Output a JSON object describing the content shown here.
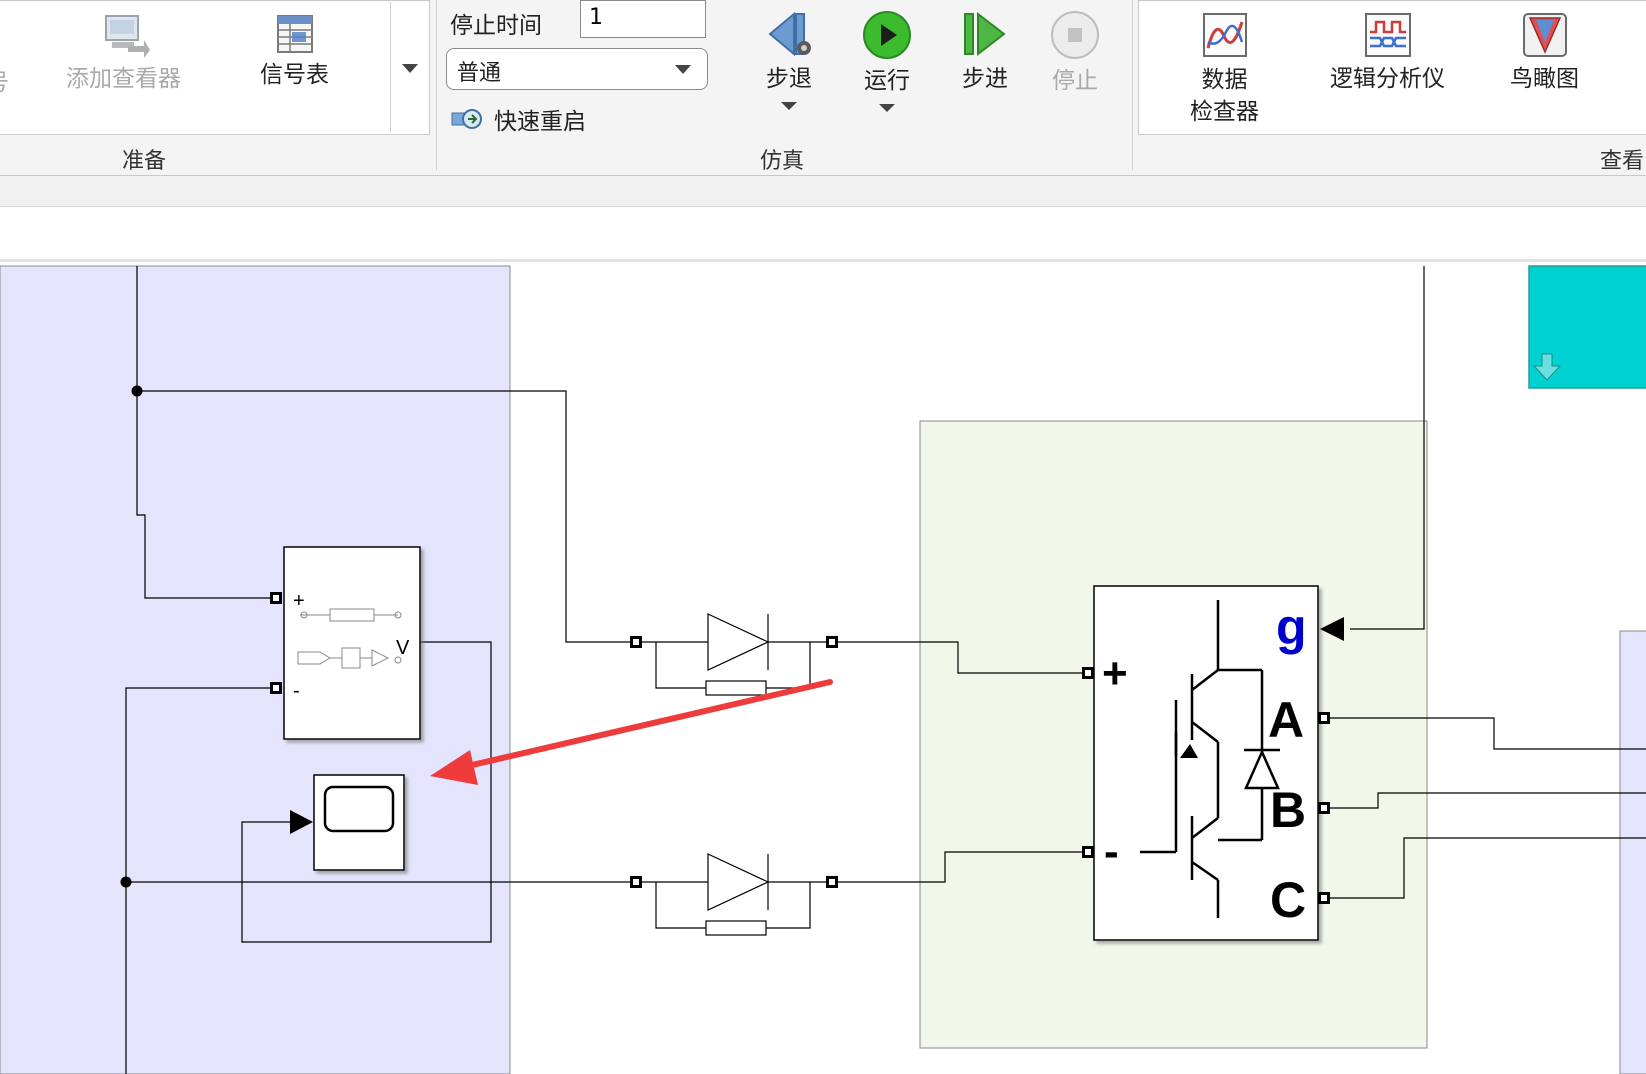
{
  "toolstrip": {
    "prepare": {
      "cut_label": "号",
      "add_viewer_label": "添加查看器",
      "signal_table_label": "信号表",
      "group_label": "准备"
    },
    "simulation": {
      "stop_time_label": "停止时间",
      "stop_time_value": "1",
      "mode_value": "普通",
      "fast_restart_label": "快速重启",
      "step_back_label": "步退",
      "run_label": "运行",
      "step_forward_label": "步进",
      "stop_label": "停止",
      "group_label": "仿真"
    },
    "review": {
      "data_inspector_line1": "数据",
      "data_inspector_line2": "检查器",
      "logic_analyzer_label": "逻辑分析仪",
      "birds_eye_label": "鸟瞰图",
      "group_label": "查看"
    }
  },
  "diagram": {
    "voltage_sensor": {
      "plus": "+",
      "minus": "-",
      "out": "V"
    },
    "igbt_bridge": {
      "g": "g",
      "plus": "+",
      "minus": "-",
      "a": "A",
      "b": "B",
      "c": "C"
    },
    "colors": {
      "subsystem_blue": "#e4e4fc",
      "subsystem_green": "#f1f7e9",
      "cyan_block": "#00d2d2",
      "annotation_arrow": "#ee3b3b",
      "g_label": "#0000cc"
    }
  }
}
